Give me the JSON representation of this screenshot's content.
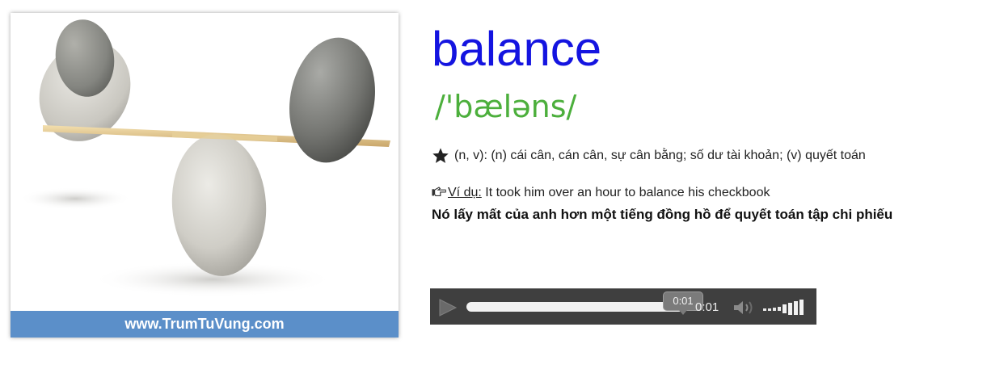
{
  "image_card": {
    "caption": "www.TrumTuVung.com",
    "caption_color": "#5b8fc9",
    "image_icon": "balancing-stones-image"
  },
  "entry": {
    "word": "balance",
    "word_color": "#1414e0",
    "phonetic": "/'bæləns/",
    "phonetic_color": "#4caf3c",
    "meaning_icon": "star-icon",
    "meaning": "(n, v): (n) cái cân, cán cân, sự cân bằng; số dư tài khoản; (v) quyết toán",
    "example_icon": "pointing-hand-icon",
    "example_label": "Ví dụ:",
    "example_en": " It took him over an hour to balance his checkbook",
    "example_vi": "Nó lấy mất của anh hơn một tiếng đồng hồ để quyết toán tập chi phiếu"
  },
  "audio_player": {
    "play_icon": "play-icon",
    "progress_fraction": 1.0,
    "hover_time": "0:01",
    "current_time": "0:01",
    "volume_icon": "speaker-icon",
    "volume_level_icon": "volume-bars-icon"
  }
}
